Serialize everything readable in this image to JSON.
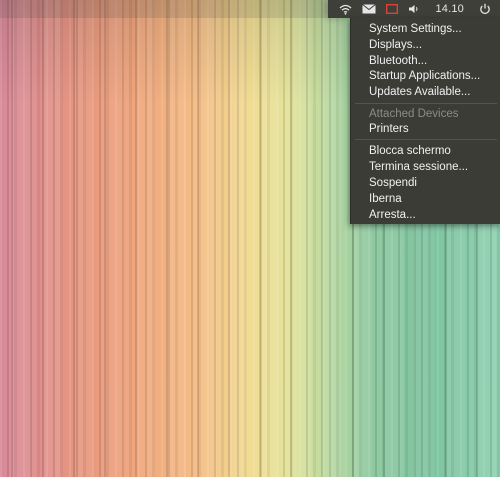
{
  "panel": {
    "clock": "14.10",
    "indicators": [
      "wifi-icon",
      "mail-icon",
      "battery-alert-icon",
      "volume-icon",
      "power-icon"
    ]
  },
  "session_menu": {
    "items_group1": [
      "System Settings...",
      "Displays...",
      "Bluetooth...",
      "Startup Applications...",
      "Updates Available..."
    ],
    "attached_header": "Attached Devices",
    "printers": "Printers",
    "items_group3": [
      "Blocca schermo",
      "Termina sessione...",
      "Sospendi",
      "Iberna",
      "Arresta..."
    ]
  },
  "colors": {
    "panel_bg": "#3f3f3a",
    "menu_bg": "#3c3c37",
    "alert_red": "#d9443a"
  }
}
